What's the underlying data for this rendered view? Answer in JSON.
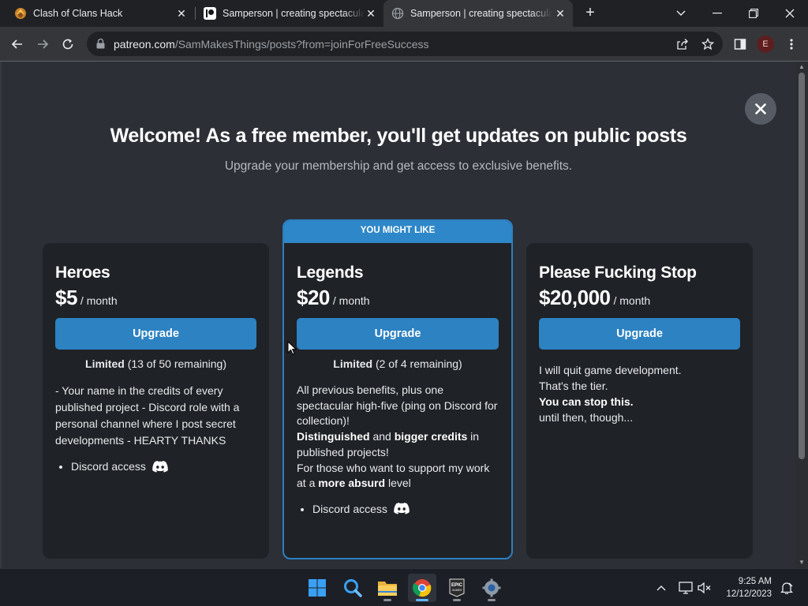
{
  "browser": {
    "tabs": [
      {
        "title": "Clash of Clans Hack",
        "favicon": "clash-of-clans-icon",
        "active": false
      },
      {
        "title": "Samperson | creating spectacular",
        "favicon": "patreon-icon",
        "active": false
      },
      {
        "title": "Samperson | creating spectacular",
        "favicon": "globe-icon",
        "active": true
      }
    ],
    "url_host": "patreon.com",
    "url_path": "/SamMakesThings/posts?from=joinForFreeSuccess",
    "profile_initial": "E"
  },
  "modal": {
    "headline": "Welcome! As a free member, you'll get updates on public posts",
    "subhead": "Upgrade your membership and get access to exclusive benefits.",
    "featured_ribbon": "YOU MIGHT LIKE",
    "tiers": [
      {
        "name": "Heroes",
        "price": "$5",
        "per": "/ month",
        "button": "Upgrade",
        "limited_label": "Limited",
        "limited_detail": "(13 of 50 remaining)",
        "description": "- Your name in the credits of every published project - Discord role with a personal channel where I post secret developments - HEARTY THANKS",
        "benefit": "Discord access"
      },
      {
        "name": "Legends",
        "price": "$20",
        "per": "/ month",
        "button": "Upgrade",
        "limited_label": "Limited",
        "limited_detail": "(2 of 4 remaining)",
        "desc_l1": "All previous benefits, plus one spectacular high-five (ping on Discord for collection)!",
        "desc_l2_b1": "Distinguished",
        "desc_l2_t1": " and ",
        "desc_l2_b2": "bigger credits",
        "desc_l2_t2": " in published projects!",
        "desc_l3_t1": "For those who want to support my work at a ",
        "desc_l3_b1": "more absurd",
        "desc_l3_t2": " level",
        "benefit": "Discord access"
      },
      {
        "name": "Please Fucking Stop",
        "price": "$20,000",
        "per": "/ month",
        "button": "Upgrade",
        "desc_l1": "I will quit game development.",
        "desc_l2": "That's the tier.",
        "desc_l3": "You can stop this.",
        "desc_l4": "until then, though..."
      }
    ]
  },
  "taskbar": {
    "time": "9:25 AM",
    "date": "12/12/2023",
    "apps": [
      "windows-start-icon",
      "search-app-icon",
      "file-explorer-icon",
      "chrome-icon",
      "epic-games-icon",
      "settings-icon"
    ]
  },
  "colors": {
    "accent": "#2d82c2",
    "card_bg": "#1f2226",
    "modal_bg": "#2c2f36"
  }
}
